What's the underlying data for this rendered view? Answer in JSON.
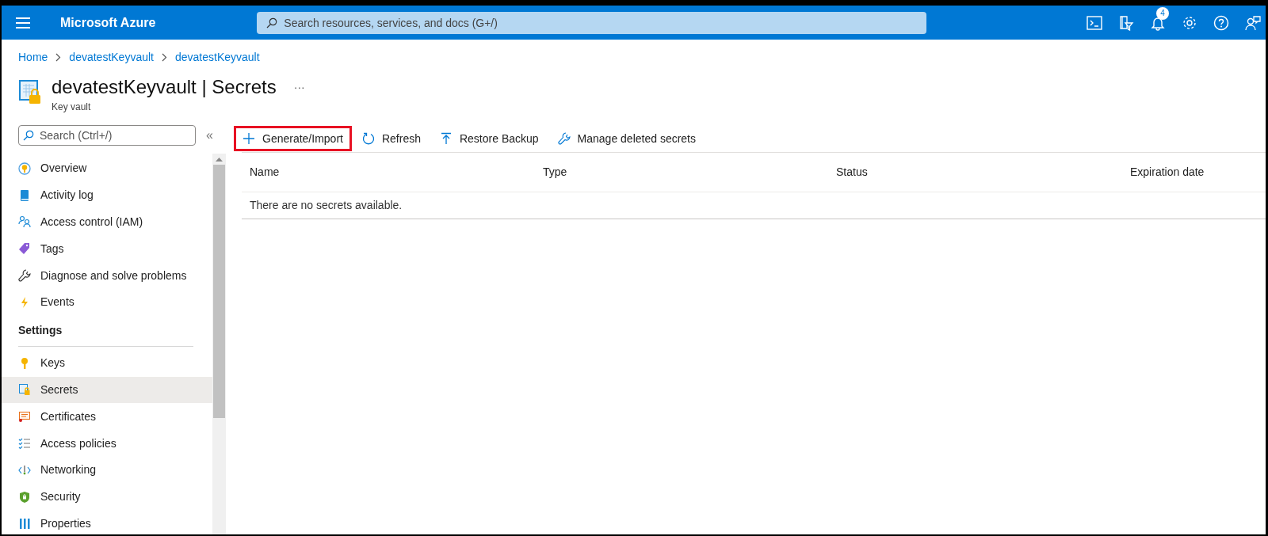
{
  "header": {
    "title": "Microsoft Azure",
    "search": {
      "placeholder": "Search resources, services, and docs (G+/)"
    },
    "notification_count": "4"
  },
  "breadcrumb": [
    "Home",
    "devatestKeyvault",
    "devatestKeyvault"
  ],
  "page": {
    "title": "devatestKeyvault | Secrets",
    "more": "···",
    "subtitle": "Key vault"
  },
  "sidebar": {
    "search": {
      "placeholder": "Search (Ctrl+/)"
    },
    "collapse": "«",
    "items": [
      {
        "kind": "item",
        "label": "Overview",
        "selected": false
      },
      {
        "kind": "item",
        "label": "Activity log",
        "selected": false
      },
      {
        "kind": "item",
        "label": "Access control (IAM)",
        "selected": false
      },
      {
        "kind": "item",
        "label": "Tags",
        "selected": false
      },
      {
        "kind": "item",
        "label": "Diagnose and solve problems",
        "selected": false
      },
      {
        "kind": "item",
        "label": "Events",
        "selected": false
      },
      {
        "kind": "heading",
        "label": "Settings"
      },
      {
        "kind": "item",
        "label": "Keys",
        "selected": false
      },
      {
        "kind": "item",
        "label": "Secrets",
        "selected": true
      },
      {
        "kind": "item",
        "label": "Certificates",
        "selected": false
      },
      {
        "kind": "item",
        "label": "Access policies",
        "selected": false
      },
      {
        "kind": "item",
        "label": "Networking",
        "selected": false
      },
      {
        "kind": "item",
        "label": "Security",
        "selected": false
      },
      {
        "kind": "item",
        "label": "Properties",
        "selected": false
      }
    ]
  },
  "toolbar": [
    {
      "label": "Generate/Import",
      "highlighted": true
    },
    {
      "label": "Refresh",
      "highlighted": false
    },
    {
      "label": "Restore Backup",
      "highlighted": false
    },
    {
      "label": "Manage deleted secrets",
      "highlighted": false
    }
  ],
  "table": {
    "columns": [
      "Name",
      "Type",
      "Status",
      "Expiration date"
    ],
    "empty_message": "There are no secrets available."
  }
}
